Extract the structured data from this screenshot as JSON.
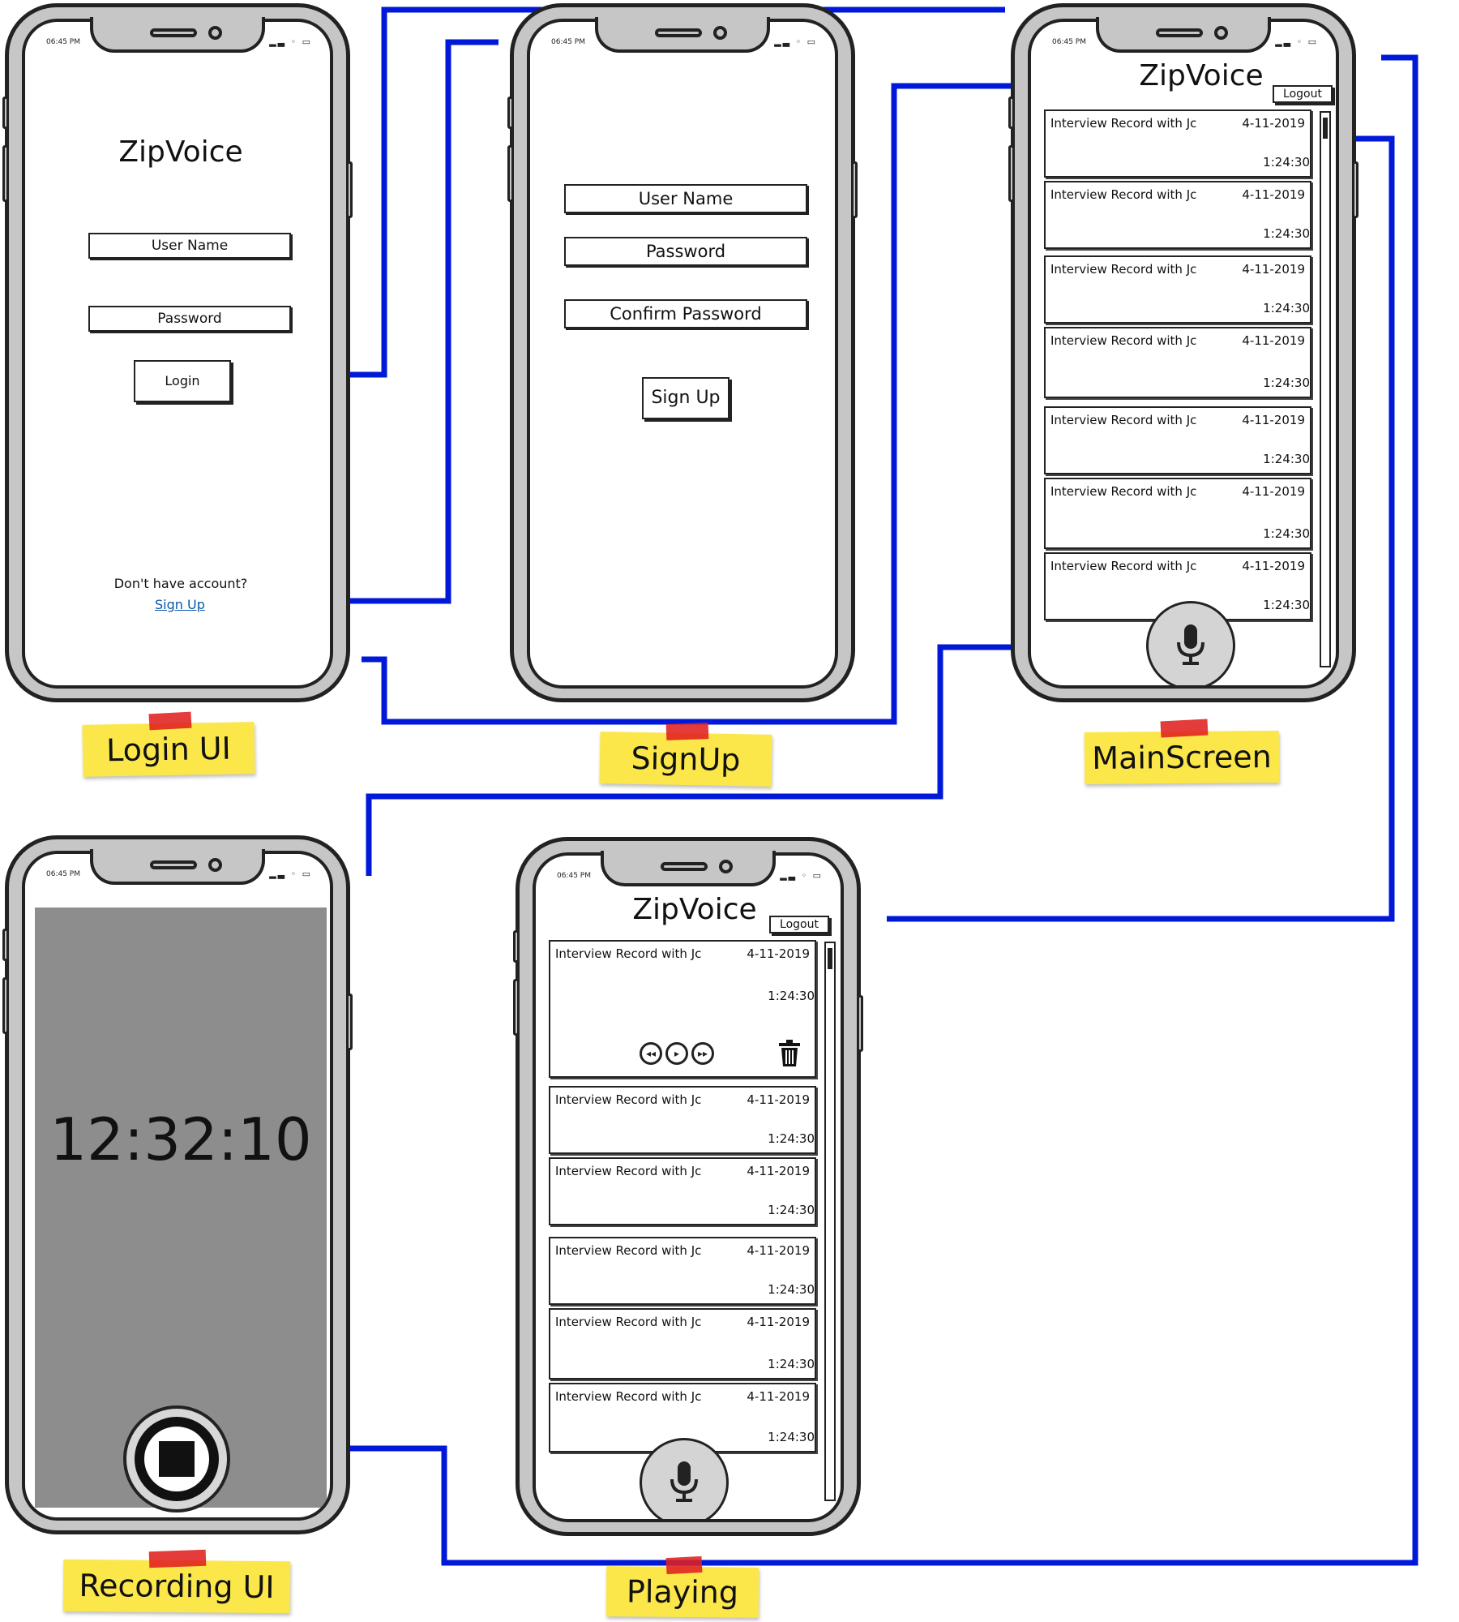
{
  "app_title": "ZipVoice",
  "status_time": "06:45 PM",
  "login": {
    "title": "ZipVoice",
    "username": "User Name",
    "password": "Password",
    "login_button": "Login",
    "no_account": "Don't have account?",
    "signup_link": "Sign Up",
    "label": "Login UI"
  },
  "signup": {
    "username": "User Name",
    "password": "Password",
    "confirm": "Confirm Password",
    "signup_button": "Sign Up",
    "label": "SignUp"
  },
  "main": {
    "title": "ZipVoice",
    "logout": "Logout",
    "label": "MainScreen",
    "records": [
      {
        "title": "Interview Record with Jc",
        "date": "4-11-2019",
        "duration": "1:24:30"
      },
      {
        "title": "Interview Record with Jc",
        "date": "4-11-2019",
        "duration": "1:24:30"
      },
      {
        "title": "Interview Record with Jc",
        "date": "4-11-2019",
        "duration": "1:24:30"
      },
      {
        "title": "Interview Record with Jc",
        "date": "4-11-2019",
        "duration": "1:24:30"
      },
      {
        "title": "Interview Record with Jc",
        "date": "4-11-2019",
        "duration": "1:24:30"
      },
      {
        "title": "Interview Record with Jc",
        "date": "4-11-2019",
        "duration": "1:24:30"
      },
      {
        "title": "Interview Record with Jc",
        "date": "4-11-2019",
        "duration": "1:24:30"
      }
    ]
  },
  "recording": {
    "clock": "12:32:10",
    "label": "Recording UI"
  },
  "playing": {
    "title": "ZipVoice",
    "logout": "Logout",
    "label": "Playing",
    "records": [
      {
        "title": "Interview Record with Jc",
        "date": "4-11-2019",
        "duration": "1:24:30"
      },
      {
        "title": "Interview Record with Jc",
        "date": "4-11-2019",
        "duration": "1:24:30"
      },
      {
        "title": "Interview Record with Jc",
        "date": "4-11-2019",
        "duration": "1:24:30"
      },
      {
        "title": "Interview Record with Jc",
        "date": "4-11-2019",
        "duration": "1:24:30"
      },
      {
        "title": "Interview Record with Jc",
        "date": "4-11-2019",
        "duration": "1:24:30"
      },
      {
        "title": "Interview Record with Jc",
        "date": "4-11-2019",
        "duration": "1:24:30"
      }
    ],
    "icons": [
      "rewind-icon",
      "play-icon",
      "fast-forward-icon",
      "trash-icon",
      "microphone-icon"
    ]
  },
  "colors": {
    "connector": "#0018d8",
    "phone_body": "#c6c6c6",
    "sticky_note": "#fbe74a",
    "tape": "#e02020",
    "recording_bg": "#8d8d8d"
  }
}
